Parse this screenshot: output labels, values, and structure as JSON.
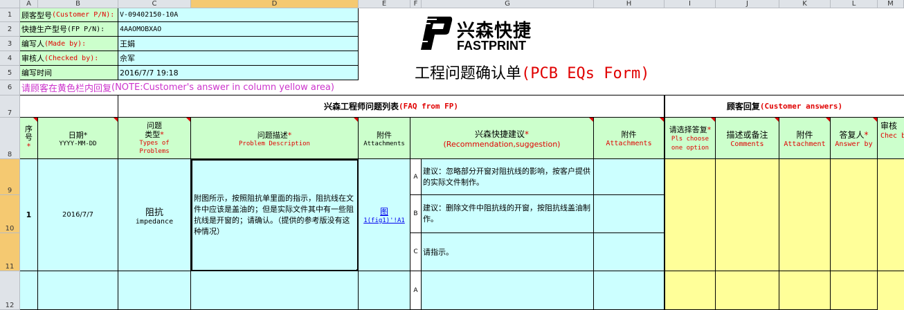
{
  "columns": [
    "A",
    "B",
    "C",
    "D",
    "E",
    "F",
    "G",
    "H",
    "I",
    "J",
    "K",
    "L",
    "M"
  ],
  "rows": [
    "1",
    "2",
    "3",
    "4",
    "5",
    "6",
    "7",
    "8",
    "9",
    "10",
    "11",
    "12"
  ],
  "info": [
    {
      "label": "顾客型号",
      "en": "(Customer P/N):",
      "value": "V-09402150-10A"
    },
    {
      "label": "快捷生产型号",
      "en": "(FP P/N):",
      "value": "4AAOMOBXAO"
    },
    {
      "label": "编写人",
      "en": "(Made by):",
      "value": "王娟"
    },
    {
      "label": "审核人",
      "en": "(Checked by):",
      "value": "佘军"
    },
    {
      "label": "编写时间",
      "en": "",
      "value": "2016/7/7 19:18"
    }
  ],
  "logo": {
    "cn": "兴森快捷",
    "en": "FASTPRINT"
  },
  "title": {
    "cn": "工程问题确认单",
    "en": "(PCB EQs Form)"
  },
  "notice": {
    "cn": "请顾客在黄色栏内回复",
    "en": "(NOTE:Customer's answer in column yellow area)"
  },
  "section": {
    "faq_cn": "兴森工程师问题列表",
    "faq_en": "(FAQ from FP)",
    "cust_cn": "顾客回复",
    "cust_en": "(Customer answers)"
  },
  "headers": {
    "seq": {
      "cn": "序号",
      "star": "*"
    },
    "date": {
      "cn": "日期",
      "star": "*",
      "en": "YYYY-MM-DD"
    },
    "type": {
      "cn1": "问题",
      "cn2": "类型",
      "star": "*",
      "en": "Types of Problems"
    },
    "desc": {
      "cn": "问题描述",
      "star": "*",
      "en": "Problem Description"
    },
    "attach": {
      "cn": "附件",
      "en": "Attachments"
    },
    "rec": {
      "cn": "兴森快捷建议",
      "star": "*",
      "en": "(Recommendation,suggestion)"
    },
    "attach2": {
      "cn": "附件",
      "en": "Attachments"
    },
    "choose": {
      "cn": "请选择答复",
      "star": "*",
      "en": "Pls choose one option"
    },
    "comments": {
      "cn": "描述或备注",
      "en": "Comments"
    },
    "attach3": {
      "cn": "附件",
      "en": "Attachment"
    },
    "answer": {
      "cn": "答复人",
      "star": "*",
      "en": "Answer by"
    },
    "check": {
      "cn": "审核",
      "en": "Chec by"
    }
  },
  "issue": {
    "seq": "1",
    "date": "2016/7/7",
    "type_cn": "阻抗",
    "type_en": "impedance",
    "description": "附图所示，按照阻抗单里面的指示，阻抗线在文件中应该是盖油的；但是实际文件其中有一些阻抗线是开窗的；请确认。（提供的参考版没有这种情况）",
    "attachment_line1": "图",
    "attachment_line2": "1(fig1)'!A1",
    "options": [
      {
        "key": "A",
        "text": "建议：忽略部分开窗对阻抗线的影响，按客户提供的实际文件制作。"
      },
      {
        "key": "B",
        "text": "建议：删除文件中阻抗线的开窗，按阻抗线盖油制作。"
      },
      {
        "key": "C",
        "text": "请指示。"
      }
    ]
  },
  "next_issue": {
    "option_a": "A"
  },
  "colors": {
    "green": "#ccffcc",
    "cyan": "#ccffff",
    "yellow": "#ffff99",
    "red": "#e00000"
  }
}
